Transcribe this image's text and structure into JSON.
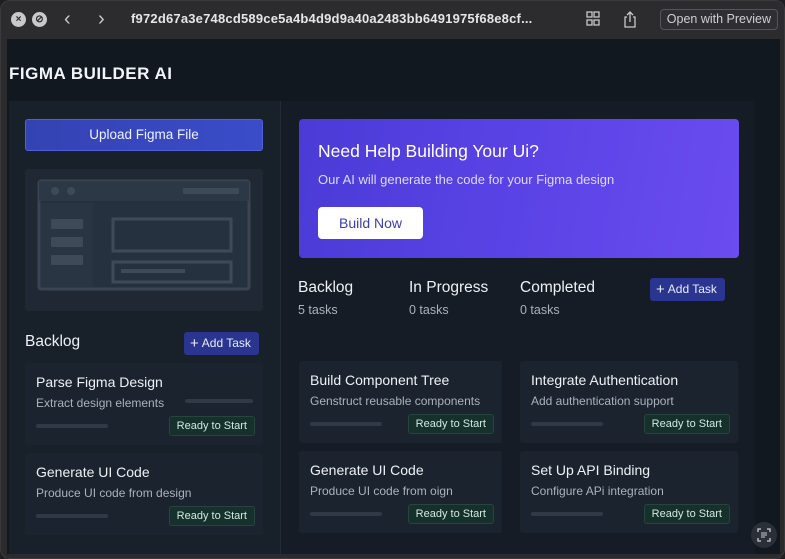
{
  "browser": {
    "url": "f972d67a3e748cd589ce5a4b4d9d9a40a2483bb6491975f68e8cf...",
    "open_preview_label": "Open with Preview",
    "close_glyph": "×",
    "stop_glyph": "⊘",
    "back_glyph": "‹",
    "forward_glyph": "›"
  },
  "app": {
    "title": "FIGMA BUILDER AI"
  },
  "sidebar": {
    "upload_label": "Upload Figma File",
    "backlog_title": "Backlog",
    "add_task_label": "Add Task",
    "tasks": [
      {
        "title": "Parse Figma Design",
        "desc": "Extract design elements",
        "status": "Ready to Start"
      },
      {
        "title": "Generate UI Code",
        "desc": "Produce UI code from design",
        "status": "Ready to Start"
      }
    ]
  },
  "hero": {
    "title": "Need Help Building Your Ui?",
    "subtitle": "Our AI will generate the code for your Figma design",
    "button_label": "Build Now"
  },
  "stats": {
    "backlog": {
      "label": "Backlog",
      "count": "5 tasks"
    },
    "in_progress": {
      "label": "In Progress",
      "count": "0 tasks"
    },
    "completed": {
      "label": "Completed",
      "count": "0 tasks"
    },
    "add_task_label": "Add Task"
  },
  "board": {
    "column_2": [
      {
        "title": "Build Component Tree",
        "desc": "Genstruct reusable components",
        "status": "Ready to Start"
      },
      {
        "title": "Generate UI Code",
        "desc": "Produce UI code from oign",
        "status": "Ready to Start"
      }
    ],
    "column_3": [
      {
        "title": "Integrate Authentication",
        "desc": "Add authentication support",
        "status": "Ready to Start"
      },
      {
        "title": "Set Up API Binding",
        "desc": "Configure APi integration",
        "status": "Ready to Start"
      }
    ]
  },
  "colors": {
    "accent": "#3a4cc9",
    "hero_gradient_start": "#4b3bd6",
    "hero_gradient_end": "#6a4cf0",
    "app_bg": "#121820",
    "badge_bg": "#16302b"
  },
  "icons": {
    "tab_overview": "grid-icon",
    "share": "share-icon",
    "screen_capture": "scan-text-icon"
  }
}
